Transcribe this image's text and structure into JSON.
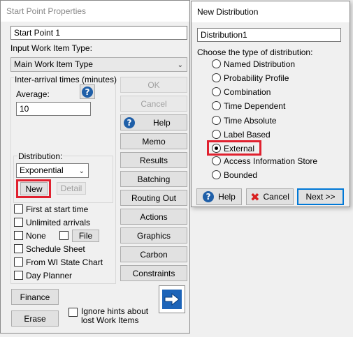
{
  "start_point": {
    "title": "Start Point Properties",
    "name_value": "Start Point 1",
    "input_work_item_type_label": "Input Work Item Type:",
    "work_item_type_value": "Main Work Item Type",
    "inter_arrival_label": "Inter-arrival times (minutes)",
    "average_label": "Average:",
    "average_help": "?",
    "average_value": "10",
    "distribution_label": "Distribution:",
    "distribution_value": "Exponential",
    "new_label": "New",
    "detail_label": "Detail",
    "checkboxes": {
      "first_at_start": "First at start time",
      "unlimited_arrivals": "Unlimited arrivals",
      "none": "None",
      "file": "File",
      "schedule_sheet": "Schedule Sheet",
      "from_wi_state_chart": "From WI State Chart",
      "day_planner": "Day Planner"
    },
    "buttons": {
      "ok": "OK",
      "cancel": "Cancel",
      "help": "Help",
      "memo": "Memo",
      "results": "Results",
      "batching": "Batching",
      "routing_out": "Routing Out",
      "actions": "Actions",
      "graphics": "Graphics",
      "carbon": "Carbon",
      "constraints": "Constraints",
      "finance": "Finance",
      "erase": "Erase"
    },
    "ignore_hints_line1": "Ignore hints about",
    "ignore_hints_line2": "lost Work Items"
  },
  "new_distribution": {
    "title": "New Distribution",
    "name_value": "Distribution1",
    "choose_label": "Choose the type of distribution:",
    "options": [
      "Named Distribution",
      "Probability Profile",
      "Combination",
      "Time Dependent",
      "Time Absolute",
      "Label Based",
      "External",
      "Access Information Store",
      "Bounded"
    ],
    "selected_option": "External",
    "help_label": "Help",
    "cancel_label": "Cancel",
    "next_label": "Next >>"
  },
  "colors": {
    "highlight": "#e0212f",
    "accent": "#0078d7",
    "help_icon": "#1f5fa8",
    "arrow_icon": "#1d64b8"
  }
}
